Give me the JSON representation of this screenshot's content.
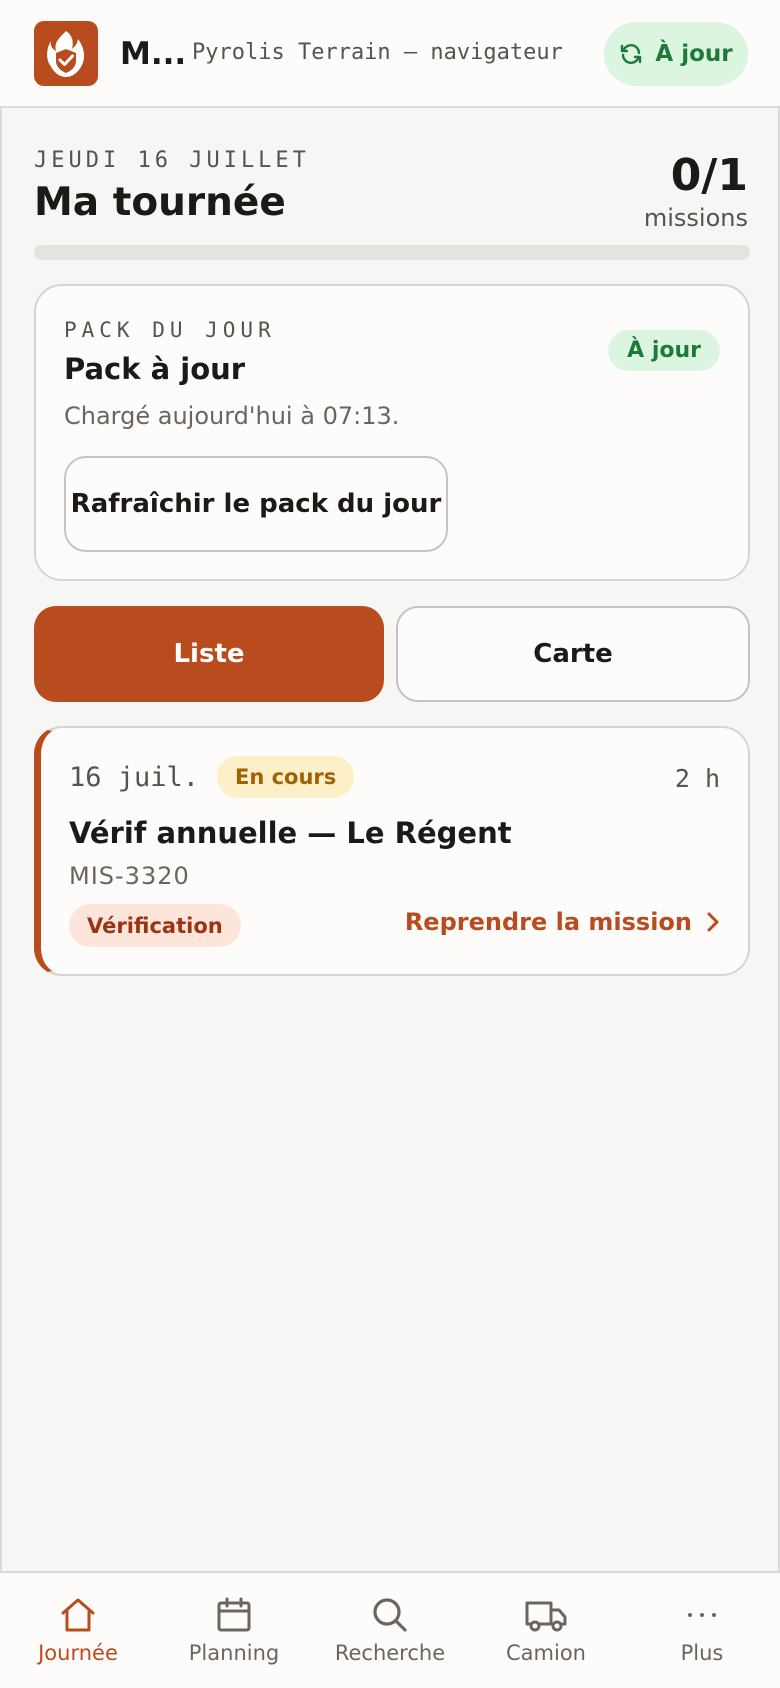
{
  "header": {
    "app_name": "M...",
    "subtitle": "Pyrolis Terrain — navigateur",
    "sync_status": "À jour",
    "icons": {
      "logo": "shield-check-flame-icon",
      "sync": "refresh-icon"
    }
  },
  "tour": {
    "date": "JEUDI 16 JUILLET",
    "title": "Ma tournée",
    "count": "0/1",
    "count_label": "missions",
    "progress": 0
  },
  "pack": {
    "eyebrow": "PACK DU JOUR",
    "title": "Pack à jour",
    "badge": "À jour",
    "description": "Chargé aujourd'hui à 07:13.",
    "refresh_label": "Rafraîchir le pack du jour"
  },
  "view_toggle": {
    "list_label": "Liste",
    "map_label": "Carte",
    "selected": "Liste"
  },
  "missions": [
    {
      "date": "16 juil.",
      "status": "En cours",
      "duration": "2 h",
      "title": "Vérif annuelle — Le Régent",
      "ref": "MIS-3320",
      "type": "Vérification",
      "action": "Reprendre la mission"
    }
  ],
  "nav": {
    "items": [
      {
        "label": "Journée",
        "icon": "home-icon",
        "active": true
      },
      {
        "label": "Planning",
        "icon": "calendar-icon",
        "active": false
      },
      {
        "label": "Recherche",
        "icon": "search-icon",
        "active": false
      },
      {
        "label": "Camion",
        "icon": "truck-icon",
        "active": false
      },
      {
        "label": "Plus",
        "icon": "more-icon",
        "active": false
      }
    ]
  },
  "colors": {
    "accent": "#b94c1e",
    "success": "#1f7a3a",
    "success_bg": "#dcf5e1",
    "warning": "#a16207",
    "warning_bg": "#fdefc7"
  }
}
